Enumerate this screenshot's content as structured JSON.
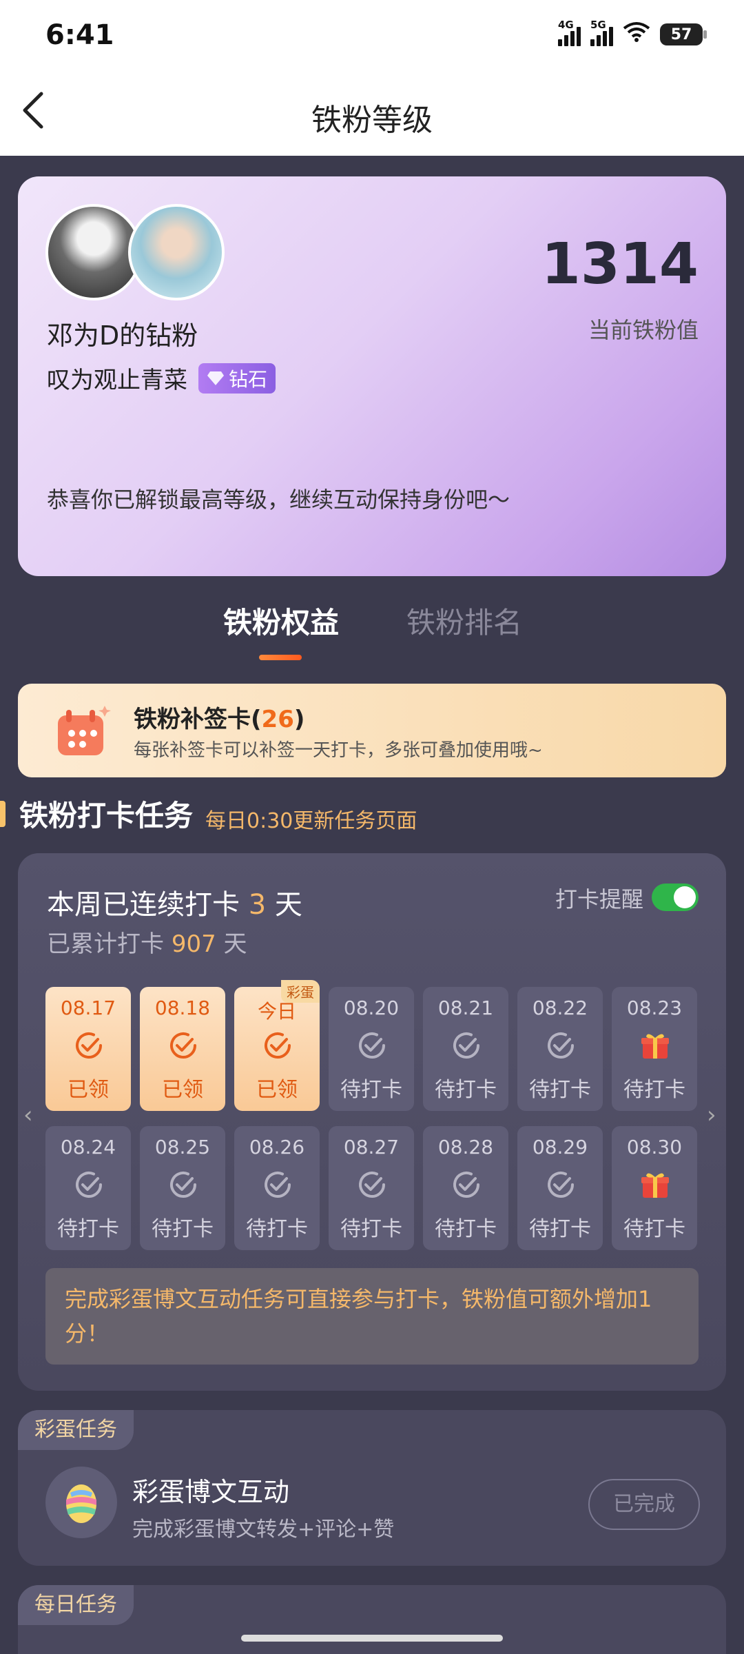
{
  "status_bar": {
    "time": "6:41",
    "net1": "4G",
    "net2": "5G",
    "battery": "57"
  },
  "header": {
    "title": "铁粉等级"
  },
  "profile": {
    "name": "邓为D的钻粉",
    "subtitle": "叹为观止青菜",
    "badge": "钻石",
    "score": "1314",
    "score_label": "当前铁粉值",
    "message": "恭喜你已解锁最高等级，继续互动保持身份吧～"
  },
  "tabs": [
    {
      "label": "铁粉权益",
      "active": true
    },
    {
      "label": "铁粉排名",
      "active": false
    }
  ],
  "card_banner": {
    "title": "铁粉补签卡(",
    "count": "26",
    "close": ")",
    "desc": "每张补签卡可以补签一天打卡，多张可叠加使用哦~"
  },
  "section": {
    "title": "铁粉打卡任务",
    "note": "每日0:30更新任务页面"
  },
  "checkin": {
    "streak_prefix": "本周已连续打卡 ",
    "streak_days": "3",
    "streak_suffix": " 天",
    "total_prefix": "已累计打卡 ",
    "total_days": "907",
    "total_suffix": " 天",
    "remind_label": "打卡提醒",
    "remind_on": true,
    "week1": [
      {
        "date": "08.17",
        "status": "已领",
        "state": "done"
      },
      {
        "date": "08.18",
        "status": "已领",
        "state": "done"
      },
      {
        "date": "今日",
        "status": "已领",
        "state": "done",
        "tag": "彩蛋"
      },
      {
        "date": "08.20",
        "status": "待打卡",
        "state": "pending"
      },
      {
        "date": "08.21",
        "status": "待打卡",
        "state": "pending"
      },
      {
        "date": "08.22",
        "status": "待打卡",
        "state": "pending"
      },
      {
        "date": "08.23",
        "status": "待打卡",
        "state": "gift"
      }
    ],
    "week2": [
      {
        "date": "08.24",
        "status": "待打卡",
        "state": "pending"
      },
      {
        "date": "08.25",
        "status": "待打卡",
        "state": "pending"
      },
      {
        "date": "08.26",
        "status": "待打卡",
        "state": "pending"
      },
      {
        "date": "08.27",
        "status": "待打卡",
        "state": "pending"
      },
      {
        "date": "08.28",
        "status": "待打卡",
        "state": "pending"
      },
      {
        "date": "08.29",
        "status": "待打卡",
        "state": "pending"
      },
      {
        "date": "08.30",
        "status": "待打卡",
        "state": "gift"
      }
    ],
    "tip": "完成彩蛋博文互动任务可直接参与打卡，铁粉值可额外增加1分！"
  },
  "egg_task": {
    "tag": "彩蛋任务",
    "title": "彩蛋博文互动",
    "desc": "完成彩蛋博文转发+评论+赞",
    "button": "已完成"
  },
  "daily_task": {
    "tag": "每日任务"
  },
  "colors": {
    "accent": "#f5b86a",
    "orange": "#f06a1a",
    "toggle_on": "#2fb54a"
  }
}
